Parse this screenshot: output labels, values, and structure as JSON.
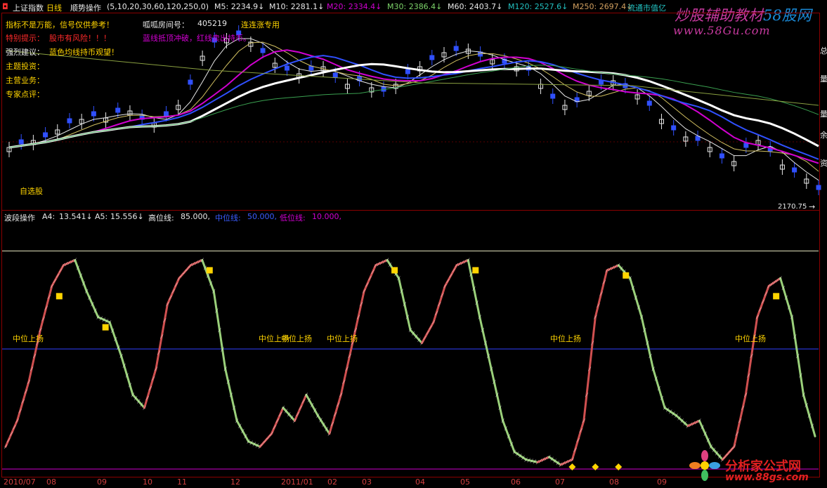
{
  "header": {
    "index_name": "上证指数",
    "period": "日线",
    "indicator": "顺势操作",
    "params": "(5,10,20,30,60,120,250,0)",
    "ma": [
      {
        "label": "M5:",
        "value": "2234.9↓",
        "color": "#e8e8e8"
      },
      {
        "label": "M10:",
        "value": "2281.1↓",
        "color": "#e8e8e8"
      },
      {
        "label": "M20:",
        "value": "2334.4↓",
        "color": "#d000d0"
      },
      {
        "label": "M30:",
        "value": "2386.4↓",
        "color": "#7dd46a"
      },
      {
        "label": "M60:",
        "value": "2403.7↓",
        "color": "#e8e8e8"
      },
      {
        "label": "M120:",
        "value": "2527.6↓",
        "color": "#22c0c0"
      },
      {
        "label": "M250:",
        "value": "2697.4↓",
        "color": "#d2a060"
      }
    ],
    "float_value_label": "流通市值亿"
  },
  "info_panel": {
    "line1": "指标不是万能，信号仅供参考！",
    "room_label": "呱呱房间号：",
    "room_number": "405219",
    "limit_up": "连连涨专用",
    "line2_label": "特别提示：",
    "line2_value": "股市有风险！！！",
    "line2_note": "蓝线抵顶冲破，红线卖出持币。",
    "line3_label": "强烈建议：",
    "line3_value": "蓝色均线持币观望！",
    "line4_label": "主题投资：",
    "line5_label": "主营业务：",
    "line6_label": "专家点评："
  },
  "main_chart": {
    "self_select": "自选股",
    "last_price": "2170.75",
    "right_axis_glyphs": [
      "总",
      "量",
      "量",
      "余",
      "资"
    ]
  },
  "sub_chart": {
    "name": "波段操作",
    "a4_label": "A4:",
    "a4_value": "13.541↓",
    "a5_label": "A5:",
    "a5_value": "15.556↓",
    "high_label": "高位线:",
    "high_value": "85.000,",
    "mid_label": "中位线:",
    "mid_value": "50.000,",
    "low_label": "低位线:",
    "low_value": "10.000,",
    "signal_labels": [
      "中位上扬",
      "中位上扬",
      "中位上扬",
      "中位上扬",
      "中位上扬",
      "中位上扬"
    ]
  },
  "x_axis": [
    "2010/07",
    "08",
    "09",
    "10",
    "11",
    "12",
    "2011/01",
    "02",
    "03",
    "04",
    "05",
    "06",
    "07",
    "08",
    "09"
  ],
  "watermarks": {
    "top_line": "炒股辅助教材",
    "top_brand": "58股网",
    "top_url": "www.58Gu.com",
    "bottom_line": "分析家公式网",
    "bottom_url": "www.88gs.com"
  },
  "colors": {
    "up": "#ff3030",
    "down": "#3050ff",
    "rise_curve": "#d05050",
    "fall_curve": "#9ad07a",
    "grid": "#8a0000"
  },
  "chart_data": [
    {
      "type": "candlestick",
      "title": "上证指数 日线",
      "series": [
        {
          "name": "M5",
          "values": []
        },
        {
          "name": "M10",
          "values": []
        },
        {
          "name": "M20",
          "values": []
        },
        {
          "name": "M30",
          "values": []
        },
        {
          "name": "M60",
          "values": []
        },
        {
          "name": "M120",
          "values": []
        },
        {
          "name": "M250",
          "values": []
        }
      ],
      "last_value": 2170.75
    },
    {
      "type": "line",
      "title": "波段操作",
      "ylim": [
        0,
        100
      ],
      "reference_lines": [
        85,
        50,
        10
      ],
      "series": [
        {
          "name": "A4",
          "values": [
            10,
            20,
            35,
            55,
            72,
            80,
            82,
            70,
            60,
            58,
            45,
            30,
            25,
            40,
            65,
            75,
            80,
            82,
            70,
            40,
            20,
            12,
            10,
            15,
            25,
            20,
            30,
            22,
            15,
            30,
            50,
            70,
            80,
            82,
            75,
            55,
            50,
            58,
            72,
            80,
            82,
            60,
            40,
            20,
            8,
            5,
            4,
            6,
            3,
            5,
            20,
            60,
            78,
            80,
            75,
            60,
            40,
            25,
            22,
            18,
            20,
            10,
            5,
            10,
            30,
            60,
            72,
            75,
            60,
            30,
            14
          ]
        }
      ]
    }
  ]
}
